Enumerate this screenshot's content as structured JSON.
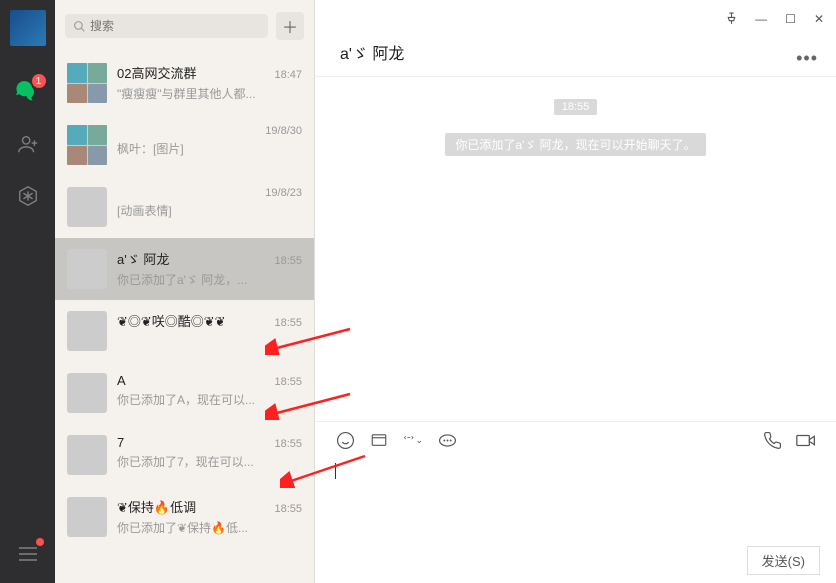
{
  "search": {
    "placeholder": "搜索"
  },
  "leftbar": {
    "badge": "1"
  },
  "chats": [
    {
      "name": "02高网交流群",
      "preview": "\"瘦瘦瘦\"与群里其他人都...",
      "time": "18:47",
      "thumb": "grid"
    },
    {
      "name": "",
      "preview": "枫叶：[图片]",
      "time": "19/8/30",
      "thumb": "grid"
    },
    {
      "name": "",
      "preview": "[动画表情]",
      "time": "19/8/23",
      "thumb": "t3"
    },
    {
      "name": "a'ゞ 阿龙",
      "preview": "你已添加了a'ゞ 阿龙，...",
      "time": "18:55",
      "thumb": "t4",
      "selected": true
    },
    {
      "name": "❦◎❦咲◎酷◎❦❦",
      "preview": "",
      "time": "18:55",
      "thumb": "t5"
    },
    {
      "name": "A",
      "preview": "你已添加了A，现在可以...",
      "time": "18:55",
      "thumb": "t6"
    },
    {
      "name": "7",
      "preview": "你已添加了7，现在可以...",
      "time": "18:55",
      "thumb": "t7"
    },
    {
      "name": "❦保持🔥低调",
      "preview": "你已添加了❦保持🔥低...",
      "time": "18:55",
      "thumb": "t8"
    }
  ],
  "chat": {
    "title": "a'ゞ 阿龙",
    "timestamp": "18:55",
    "sysmsg": "你已添加了a'ゞ 阿龙，现在可以开始聊天了。"
  },
  "send": {
    "label": "发送(S)"
  }
}
